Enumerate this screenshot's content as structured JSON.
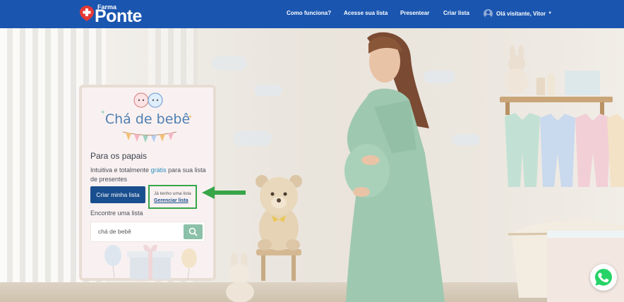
{
  "header": {
    "logo_small": "Farma",
    "logo_big": "Ponte",
    "nav": [
      "Como funciona?",
      "Acesse sua lista",
      "Presentear",
      "Criar lista"
    ],
    "user_label": "Olá visitante, Vitor"
  },
  "card": {
    "title": "Chá de bebê",
    "section_heading": "Para os papais",
    "desc_before": "Intuitiva e totalmente ",
    "desc_highlight": "grátis",
    "desc_after": " para sua lista de presentes",
    "create_button": "Criar minha lista",
    "have_list_text": "Já tenho uma lista",
    "manage_link": "Gerenciar lista",
    "find_label": "Encontre uma lista",
    "search_value": "chá de bebê"
  },
  "colors": {
    "header_bg": "#1a56b0",
    "primary_button": "#1a4f8f",
    "highlight_border": "#37a548",
    "search_button": "#8cc1a9",
    "whatsapp": "#25d366"
  },
  "icons": [
    "logo-pin-icon",
    "user-avatar-icon",
    "chevron-down-icon",
    "search-icon",
    "green-arrow-icon",
    "whatsapp-icon"
  ]
}
